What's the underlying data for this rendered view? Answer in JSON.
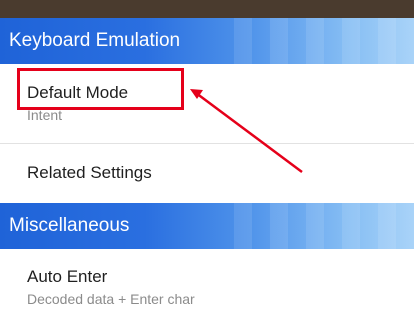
{
  "sections": {
    "keyboard_emulation": {
      "title": "Keyboard Emulation"
    },
    "miscellaneous": {
      "title": "Miscellaneous"
    }
  },
  "items": {
    "default_mode": {
      "title": "Default Mode",
      "value": "Intent"
    },
    "related_settings": {
      "title": "Related Settings"
    },
    "auto_enter": {
      "title": "Auto Enter",
      "value": "Decoded data + Enter char"
    }
  },
  "annotation": {
    "highlight_color": "#e5001a",
    "target": "Default Mode"
  }
}
